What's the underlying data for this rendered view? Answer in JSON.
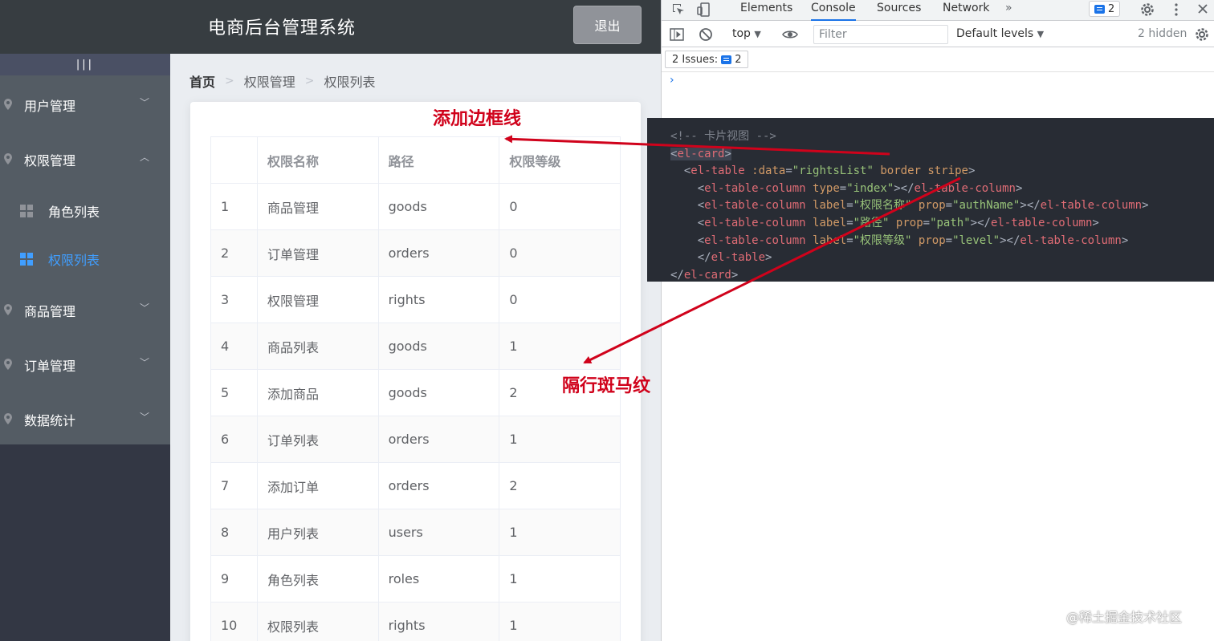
{
  "app": {
    "title": "电商后台管理系统",
    "logout_label": "退出",
    "toggle_label": "|||",
    "menu": [
      {
        "label": "用户管理",
        "arrow": "﹀"
      },
      {
        "label": "权限管理",
        "arrow": "︿"
      },
      {
        "label": "商品管理",
        "arrow": "﹀"
      },
      {
        "label": "订单管理",
        "arrow": "﹀"
      },
      {
        "label": "数据统计",
        "arrow": "﹀"
      }
    ],
    "submenu": [
      {
        "label": "角色列表"
      },
      {
        "label": "权限列表"
      }
    ],
    "breadcrumb": {
      "home": "首页",
      "items": [
        "权限管理",
        "权限列表"
      ],
      "separator": ">"
    },
    "table": {
      "headers": [
        "",
        "权限名称",
        "路径",
        "权限等级"
      ],
      "rows": [
        [
          "1",
          "商品管理",
          "goods",
          "0"
        ],
        [
          "2",
          "订单管理",
          "orders",
          "0"
        ],
        [
          "3",
          "权限管理",
          "rights",
          "0"
        ],
        [
          "4",
          "商品列表",
          "goods",
          "1"
        ],
        [
          "5",
          "添加商品",
          "goods",
          "2"
        ],
        [
          "6",
          "订单列表",
          "orders",
          "1"
        ],
        [
          "7",
          "添加订单",
          "orders",
          "2"
        ],
        [
          "8",
          "用户列表",
          "users",
          "1"
        ],
        [
          "9",
          "角色列表",
          "roles",
          "1"
        ],
        [
          "10",
          "权限列表",
          "rights",
          "1"
        ]
      ]
    }
  },
  "devtools": {
    "tabs": [
      "Elements",
      "Console",
      "Sources",
      "Network"
    ],
    "active_tab": "Console",
    "more_tabs": "»",
    "issues_badge": "2",
    "toolbar": {
      "context": "top",
      "filter_placeholder": "Filter",
      "levels": "Default levels",
      "hidden": "2 hidden"
    },
    "issues_label": "2 Issues:",
    "issues_count": "2",
    "prompt": "›"
  },
  "code": {
    "lines": [
      "<!-- 卡片视图 -->",
      "<el-card>",
      "  <el-table :data=\"rightsList\" border stripe>",
      "    <el-table-column type=\"index\"></el-table-column>",
      "    <el-table-column label=\"权限名称\" prop=\"authName\"></el-table-column>",
      "    <el-table-column label=\"路径\" prop=\"path\"></el-table-column>",
      "    <el-table-column label=\"权限等级\" prop=\"level\"></el-table-column>",
      "    </el-table>",
      "</el-card>"
    ]
  },
  "annotations": {
    "border": "添加边框线",
    "stripe": "隔行斑马纹",
    "color": "#d0021b"
  },
  "watermark": "@稀土掘金技术社区"
}
